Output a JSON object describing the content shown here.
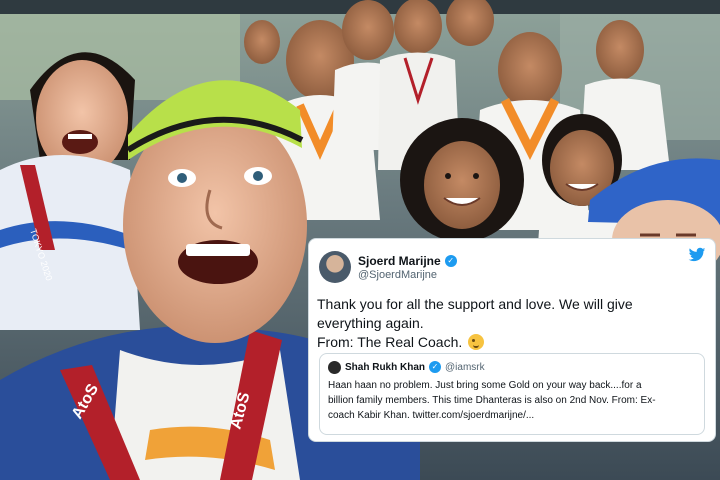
{
  "photo": {
    "description_icon": "team-selfie-photo",
    "lanyard_text": "AtoS",
    "badge_text": "TOKYO 2020"
  },
  "tweet": {
    "author_name": "Sjoerd Marijne",
    "author_handle": "@SjoerdMarijne",
    "verified_icon": "verified-badge-icon",
    "platform_icon": "twitter-bird-icon",
    "body_lines": [
      "Thank you for all the support and love. We will give",
      "everything again.",
      "From: The Real Coach."
    ],
    "emoji_icon": "winking-face-emoji",
    "quoted": {
      "author_name": "Shah Rukh Khan",
      "author_handle": "@iamsrk",
      "body_lines": [
        "Haan haan no problem. Just bring some Gold on your way back....for a",
        "billion family members. This time Dhanteras is also on 2nd Nov. From: Ex-",
        "coach Kabir Khan. twitter.com/sjoerdmarijne/..."
      ]
    }
  },
  "colors": {
    "twitter_blue": "#1d9bf0",
    "cap_green": "#b8e04a",
    "india_saffron": "#f28c28",
    "lanyard_red": "#b3202a"
  }
}
